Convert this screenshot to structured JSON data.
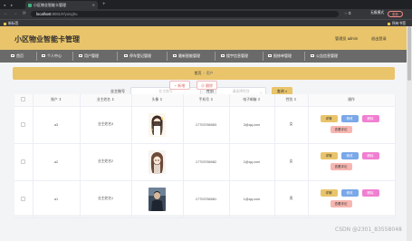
{
  "browser": {
    "tab_title": "小区物业智能卡管理",
    "url_host": "localhost",
    "url_path": ":8081/#/yonghu",
    "profile": "无痕模式",
    "update_label": "更新",
    "window_dots": "● ●",
    "nav_glyphs": "← → ⟳",
    "right_glyphs": "☆  ⧉",
    "bookmarks": [
      {
        "label": "新标签"
      },
      {
        "label": "所有书签"
      }
    ]
  },
  "header": {
    "title": "小区物业智能卡管理",
    "user_label": "管理员 admin",
    "logout_label": "退出登录"
  },
  "nav": {
    "items": [
      {
        "label": "首页"
      },
      {
        "label": "个人中心"
      },
      {
        "label": "用户管理"
      },
      {
        "label": "停车登记管理"
      },
      {
        "label": "最新智能管理"
      },
      {
        "label": "楼宇信息管理"
      },
      {
        "label": "报修单管理"
      },
      {
        "label": "公告信息管理"
      }
    ]
  },
  "breadcrumb": {
    "home": "首页",
    "separator": "/",
    "current": "用户"
  },
  "search": {
    "account_label": "业主账号",
    "account_placeholder": "业主账号",
    "gender_label": "性别",
    "gender_placeholder": "请选择性别",
    "query_label": "查询",
    "query_icon": "⌕"
  },
  "actions": {
    "add_label": "+ 新增",
    "delete_label": "删除",
    "delete_icon": "⊘"
  },
  "table": {
    "headers": [
      "",
      "账户",
      "业主姓名",
      "头像",
      "手机号",
      "电子邮箱",
      "性别",
      "操作"
    ],
    "sort_indicator": "⇕",
    "rows": [
      {
        "account": "a3",
        "name": "业主姓名3",
        "phone": "17703786983",
        "email": "3@qq.com",
        "gender": "女",
        "avatar": "girl-cartoon"
      },
      {
        "account": "a2",
        "name": "业主姓名2",
        "phone": "17703786982",
        "email": "2@qq.com",
        "gender": "女",
        "avatar": "anime-girl"
      },
      {
        "account": "a1",
        "name": "业主姓名1",
        "phone": "17703786981",
        "email": "1@qq.com",
        "gender": "男",
        "avatar": "person-photo"
      }
    ],
    "op_labels": {
      "detail": "详情",
      "edit": "修改",
      "delete": "删除",
      "review": "查看评论"
    }
  },
  "watermark": "CSDN @2301_83558048"
}
